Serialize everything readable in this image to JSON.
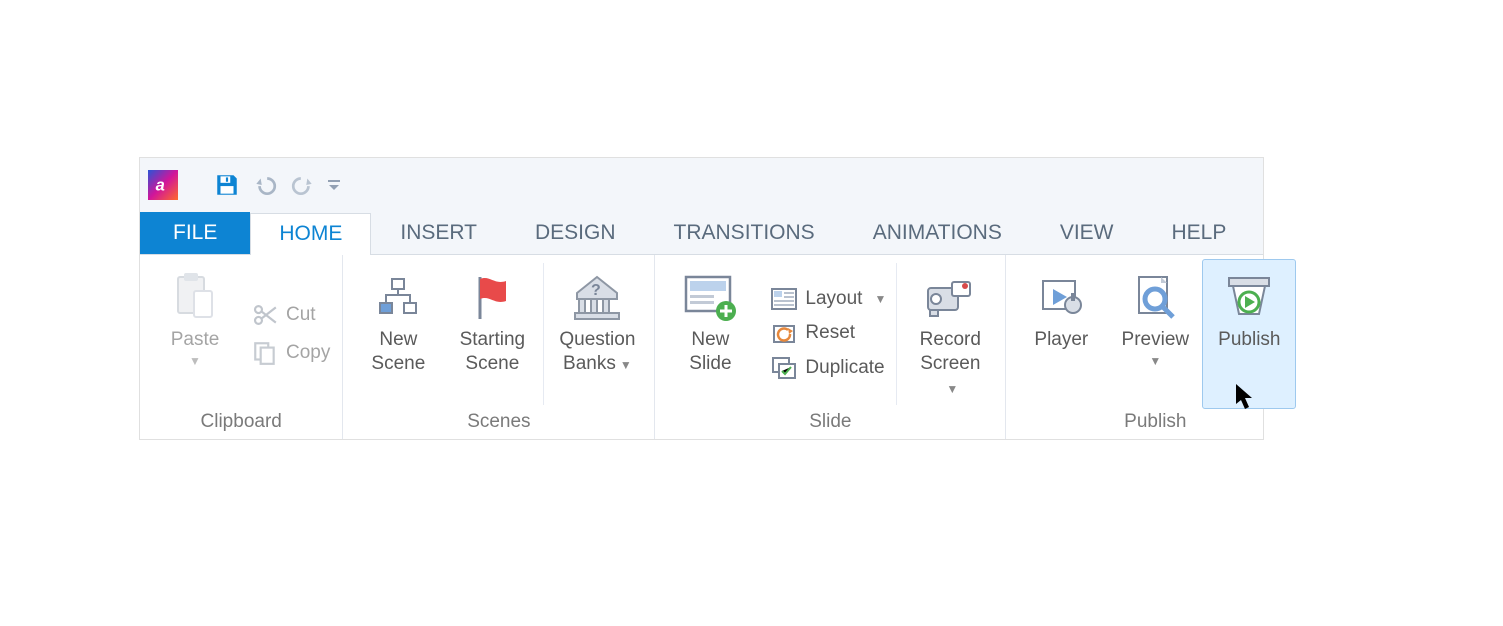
{
  "tabs": {
    "file": "FILE",
    "home": "HOME",
    "insert": "INSERT",
    "design": "DESIGN",
    "transitions": "TRANSITIONS",
    "animations": "ANIMATIONS",
    "view": "VIEW",
    "help": "HELP"
  },
  "groups": {
    "clipboard": {
      "label": "Clipboard",
      "paste": "Paste",
      "cut": "Cut",
      "copy": "Copy"
    },
    "scenes": {
      "label": "Scenes",
      "new_scene": "New\nScene",
      "starting_scene": "Starting\nScene",
      "question_banks": "Question\nBanks"
    },
    "slide": {
      "label": "Slide",
      "new_slide": "New\nSlide",
      "layout": "Layout",
      "reset": "Reset",
      "duplicate": "Duplicate",
      "record_screen": "Record\nScreen"
    },
    "publish": {
      "label": "Publish",
      "player": "Player",
      "preview": "Preview",
      "publish": "Publish"
    }
  }
}
